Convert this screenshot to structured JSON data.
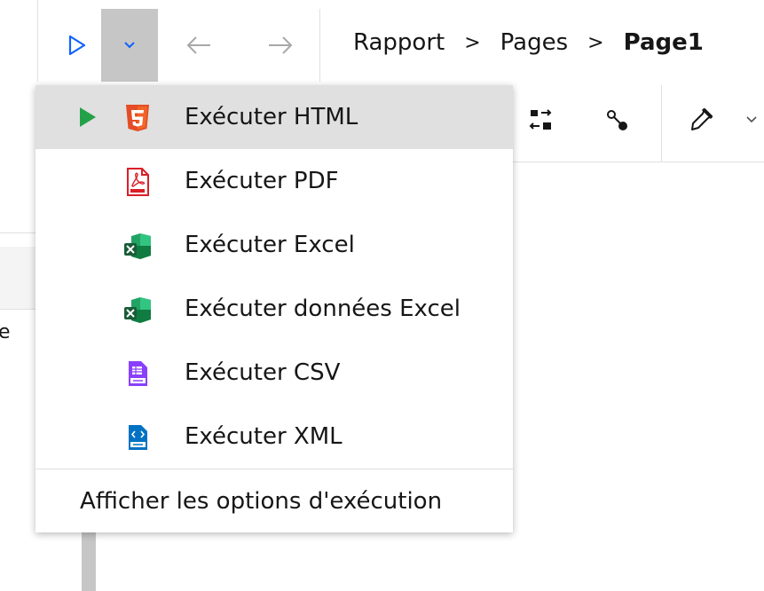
{
  "toolbar": {
    "run_icon": "play-outline-icon",
    "dropdown_icon": "chevron-down-icon",
    "back_icon": "arrow-left-icon",
    "forward_icon": "arrow-right-icon",
    "accent_color": "#0f62fe"
  },
  "breadcrumb": {
    "items": [
      "Rapport",
      "Pages",
      "Page1"
    ],
    "separator": ">"
  },
  "left_panel": {
    "cut_text": "e"
  },
  "secondary_toolbar": {
    "icons": [
      "swap-icon",
      "key-icon",
      "dropper-icon",
      "chevron-down-icon"
    ]
  },
  "run_menu": {
    "items": [
      {
        "label": "Exécuter HTML",
        "icon": "html5-icon",
        "active": true,
        "color": "#e44d26"
      },
      {
        "label": "Exécuter PDF",
        "icon": "pdf-icon",
        "active": false,
        "color": "#da1e28"
      },
      {
        "label": "Exécuter Excel",
        "icon": "excel-icon",
        "active": false,
        "color": "#1e7145"
      },
      {
        "label": "Exécuter données Excel",
        "icon": "excel-data-icon",
        "active": false,
        "color": "#1e7145"
      },
      {
        "label": "Exécuter CSV",
        "icon": "csv-icon",
        "active": false,
        "color": "#8a3ffc"
      },
      {
        "label": "Exécuter XML",
        "icon": "xml-icon",
        "active": false,
        "color": "#0072c3"
      }
    ],
    "active_play_color": "#24a148",
    "options_label": "Afficher les options d'exécution"
  }
}
